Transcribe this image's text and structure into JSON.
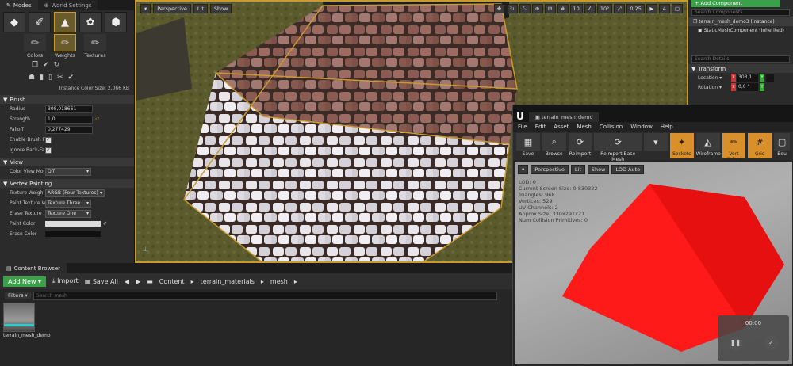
{
  "modes": {
    "tabs": [
      "Modes",
      "World Settings"
    ],
    "subtools": [
      "Colors",
      "Weights",
      "Textures"
    ],
    "cache_size": "Instance Color Size: 2,066 KB",
    "brush_section": "Brush",
    "radius_label": "Radius",
    "radius_value": "308,018661",
    "strength_label": "Strength",
    "strength_value": "1,0",
    "falloff_label": "Falloff",
    "falloff_value": "0,277429",
    "enable_brush_label": "Enable Brush F",
    "ignore_back_label": "Ignore Back-Fa",
    "view_section": "View",
    "color_view_label": "Color View Mo",
    "color_view_value": "Off",
    "vertex_section": "Vertex Painting",
    "texture_weight_label": "Texture Weigh",
    "texture_weight_value": "ARGB (Four Textures)",
    "paint_texture_label": "Paint Texture W",
    "paint_texture_value": "Texture Three",
    "erase_texture_label": "Erase Texture",
    "erase_texture_value": "Texture One",
    "paint_color_label": "Paint Color",
    "erase_color_label": "Erase Color"
  },
  "viewport": {
    "perspective": "Perspective",
    "lit": "Lit",
    "show": "Show",
    "grid": "10",
    "rot": "10°",
    "scale": "0,25",
    "cam": "4"
  },
  "details": {
    "add_component": "+ Add Component",
    "search_components": "Search Components",
    "instance": "terrain_mesh_demo3 (Instance)",
    "component": "StaticMeshComponent (Inherited)",
    "search_details": "Search Details",
    "transform": "Transform",
    "location_label": "Location ▾",
    "location_x": "303,1",
    "location_y": "",
    "rotation_label": "Rotation ▾",
    "rotation_x": "0,0 °"
  },
  "content_browser": {
    "tab": "Content Browser",
    "add_new": "Add New ▾",
    "import": "Import",
    "save_all": "Save All",
    "crumbs": [
      "Content",
      "terrain_materials",
      "mesh"
    ],
    "filters": "Filters ▾",
    "search_placeholder": "Search mesh",
    "asset_label": "terrain_mesh_demo"
  },
  "mesh_editor": {
    "tab": "terrain_mesh_demo",
    "menu": [
      "File",
      "Edit",
      "Asset",
      "Mesh",
      "Collision",
      "Window",
      "Help"
    ],
    "tools": [
      "Save",
      "Browse",
      "Reimport",
      "Reimport Base Mesh",
      "Sockets",
      "Wireframe",
      "Vert Colors",
      "Grid",
      "Bou"
    ],
    "perspective": "Perspective",
    "lit": "Lit",
    "show": "Show",
    "lod": "LOD Auto",
    "stats": [
      "LOD:  0",
      "Current Screen Size:  0.830322",
      "Triangles:  968",
      "Vertices:  529",
      "UV Channels:  2",
      "Approx Size: 330x291x21",
      "Num Collision Primitives:  0"
    ],
    "recorder_time": "00:00"
  }
}
